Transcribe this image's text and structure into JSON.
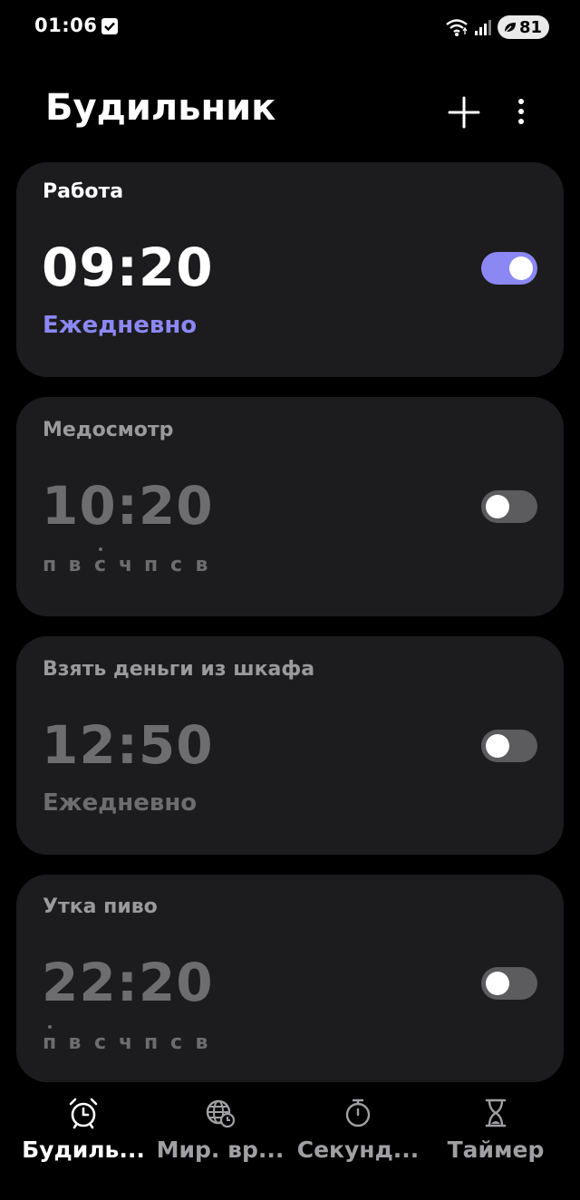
{
  "status_bar": {
    "time": "01:06",
    "battery": "81"
  },
  "header": {
    "title": "Будильник"
  },
  "alarms": [
    {
      "label": "Работа",
      "time": "09:20",
      "repeat": "Ежедневно",
      "enabled": true
    },
    {
      "label": "Медосмотр",
      "time": "10:20",
      "days": [
        "п",
        "в",
        "с",
        "ч",
        "п",
        "с",
        "в"
      ],
      "marked_day_index": 2,
      "enabled": false
    },
    {
      "label": "Взять деньги из шкафа",
      "time": "12:50",
      "repeat": "Ежедневно",
      "enabled": false
    },
    {
      "label": "Утка пиво",
      "time": "22:20",
      "days": [
        "п",
        "в",
        "с",
        "ч",
        "п",
        "с",
        "в"
      ],
      "marked_day_index": 0,
      "enabled": false
    }
  ],
  "bottom_nav": [
    {
      "label": "Будиль...",
      "icon": "alarm-clock-icon",
      "active": true
    },
    {
      "label": "Мир. вр...",
      "icon": "world-clock-icon",
      "active": false
    },
    {
      "label": "Секунд...",
      "icon": "stopwatch-icon",
      "active": false
    },
    {
      "label": "Таймер",
      "icon": "hourglass-icon",
      "active": false
    }
  ],
  "colors": {
    "accent": "#8b87f3",
    "card": "#1c1c1e",
    "inactive_text": "#6d6d70"
  }
}
